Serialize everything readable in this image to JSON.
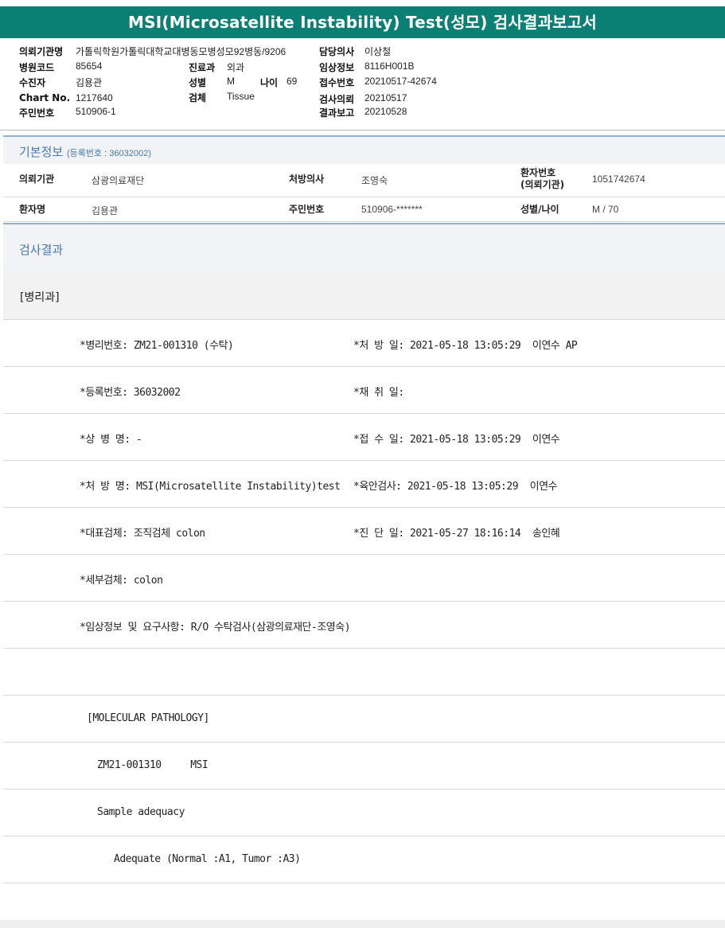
{
  "report_title": "MSI(Microsatellite Instability) Test(성모) 검사결과보고서",
  "header": {
    "requesting_institution": {
      "label": "의뢰기관명",
      "value": "가톨릭학원가톨릭대학교대병동모병성모92병동/9206"
    },
    "hospital_code": {
      "label": "병원코드",
      "value": "85654"
    },
    "recipient": {
      "label": "수진자",
      "value": "김용관"
    },
    "chart_no": {
      "label": "Chart No.",
      "value": "1217640"
    },
    "resident_no": {
      "label": "주민번호",
      "value": "510906-1"
    },
    "department": {
      "label": "진료과",
      "value": "외과"
    },
    "sex": {
      "label": "성별",
      "value": "M"
    },
    "age": {
      "label": "나이",
      "value": "69"
    },
    "specimen": {
      "label": "검체",
      "value": "Tissue"
    },
    "attending_doctor": {
      "label": "담당의사",
      "value": "이상철"
    },
    "clinical_info": {
      "label": "임상정보",
      "value": "8116H001B"
    },
    "receipt_no": {
      "label": "접수번호",
      "value": "20210517-42674"
    },
    "test_request": {
      "label": "검사의뢰",
      "value": "20210517"
    },
    "result_report": {
      "label": "결과보고",
      "value": "20210528"
    }
  },
  "basic_info": {
    "title": "기본정보",
    "reg_no_text": "(등록번호 : 36032002)",
    "rows": [
      [
        {
          "label": "의뢰기관",
          "value": "삼광의료재단"
        },
        {
          "label": "처방의사",
          "value": "조영숙"
        },
        {
          "label_line1": "환자번호",
          "label_line2": "(의뢰기관)",
          "value": "1051742674"
        }
      ],
      [
        {
          "label": "환자명",
          "value": "김용관"
        },
        {
          "label": "주민번호",
          "value": "510906-*******"
        },
        {
          "label": "성별/나이",
          "value": "M / 70"
        }
      ]
    ]
  },
  "results": {
    "title": "검사결과",
    "department_label": "[병리과]",
    "rows": [
      {
        "left": "*병리번호: ZM21-001310 (수탁)",
        "right": "*처 방 일: 2021-05-18 13:05:29  이연수 AP"
      },
      {
        "left": "*등록번호: 36032002",
        "right": "*채 취 일:"
      },
      {
        "left": "*상 병 명: -",
        "right": "*접 수 일: 2021-05-18 13:05:29  이연수"
      },
      {
        "left": "*처 방 명: MSI(Microsatellite Instability)test",
        "right": "*육안검사: 2021-05-18 13:05:29  이연수"
      },
      {
        "left": "*대표검체: 조직검체 colon",
        "right": "*진 단 일: 2021-05-27 18:16:14  송인혜"
      },
      {
        "left": "*세부검체: colon",
        "right": ""
      },
      {
        "left": "*임상정보 및 요구사항: R/O 수탁검사(삼광의료재단-조영숙)",
        "right": ""
      },
      {
        "left": "",
        "right": ""
      }
    ],
    "molecular": [
      {
        "text": "[MOLECULAR PATHOLOGY]",
        "indent": 1
      },
      {
        "text": "ZM21-001310     MSI",
        "indent": 2
      },
      {
        "text": "Sample adequacy",
        "indent": 2
      },
      {
        "text": "Adequate (Normal :A1, Tumor :A3)",
        "indent": 3
      }
    ]
  }
}
